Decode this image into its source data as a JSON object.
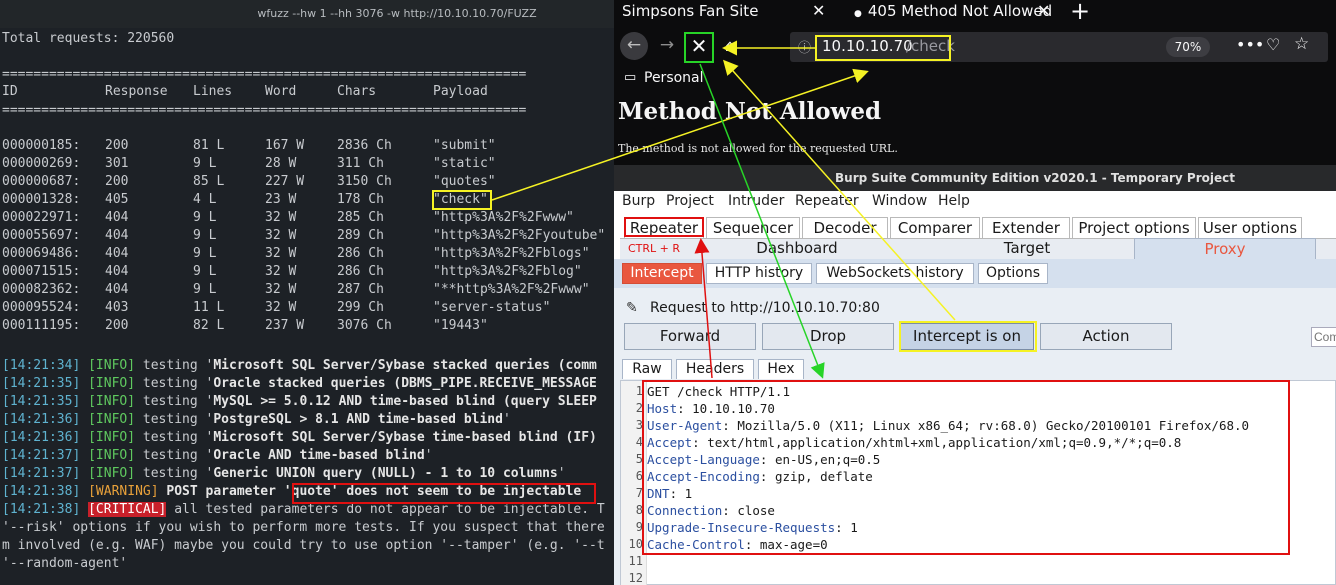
{
  "terminal": {
    "title": "wfuzz --hw 1 --hh 3076 -w http://10.10.10.70/FUZZ",
    "total_requests": "Total requests: 220560",
    "separator": "===================================================================",
    "headers": {
      "id": "ID",
      "response": "Response",
      "lines": "Lines",
      "word": "Word",
      "chars": "Chars",
      "payload": "Payload"
    },
    "rows": [
      {
        "id": "000000185:",
        "response": "200",
        "lines": "81 L",
        "word": "167 W",
        "chars": "2836 Ch",
        "payload": "\"submit\""
      },
      {
        "id": "000000269:",
        "response": "301",
        "lines": "9 L",
        "word": "28 W",
        "chars": "311 Ch",
        "payload": "\"static\""
      },
      {
        "id": "000000687:",
        "response": "200",
        "lines": "85 L",
        "word": "227 W",
        "chars": "3150 Ch",
        "payload": "\"quotes\""
      },
      {
        "id": "000001328:",
        "response": "405",
        "lines": "4 L",
        "word": "23 W",
        "chars": "178 Ch",
        "payload": "\"check\""
      },
      {
        "id": "000022971:",
        "response": "404",
        "lines": "9 L",
        "word": "32 W",
        "chars": "285 Ch",
        "payload": "\"http%3A%2F%2Fwww\""
      },
      {
        "id": "000055697:",
        "response": "404",
        "lines": "9 L",
        "word": "32 W",
        "chars": "289 Ch",
        "payload": "\"http%3A%2F%2Fyoutube\""
      },
      {
        "id": "000069486:",
        "response": "404",
        "lines": "9 L",
        "word": "32 W",
        "chars": "286 Ch",
        "payload": "\"http%3A%2F%2Fblogs\""
      },
      {
        "id": "000071515:",
        "response": "404",
        "lines": "9 L",
        "word": "32 W",
        "chars": "286 Ch",
        "payload": "\"http%3A%2F%2Fblog\""
      },
      {
        "id": "000082362:",
        "response": "404",
        "lines": "9 L",
        "word": "32 W",
        "chars": "287 Ch",
        "payload": "\"**http%3A%2F%2Fwww\""
      },
      {
        "id": "000095524:",
        "response": "403",
        "lines": "11 L",
        "word": "32 W",
        "chars": "299 Ch",
        "payload": "\"server-status\""
      },
      {
        "id": "000111195:",
        "response": "200",
        "lines": "82 L",
        "word": "237 W",
        "chars": "3076 Ch",
        "payload": "\"19443\""
      }
    ],
    "logs": [
      {
        "ts": "[14:21:34]",
        "level": "[INFO]",
        "pre": " testing '",
        "bold": "Microsoft SQL Server/Sybase stacked queries (comm",
        "post": ""
      },
      {
        "ts": "[14:21:35]",
        "level": "[INFO]",
        "pre": " testing '",
        "bold": "Oracle stacked queries (DBMS_PIPE.RECEIVE_MESSAGE",
        "post": ""
      },
      {
        "ts": "[14:21:35]",
        "level": "[INFO]",
        "pre": " testing '",
        "bold": "MySQL >= 5.0.12 AND time-based blind (query SLEEP",
        "post": ""
      },
      {
        "ts": "[14:21:36]",
        "level": "[INFO]",
        "pre": " testing '",
        "bold": "PostgreSQL > 8.1 AND time-based blind",
        "post": "'"
      },
      {
        "ts": "[14:21:36]",
        "level": "[INFO]",
        "pre": " testing '",
        "bold": "Microsoft SQL Server/Sybase time-based blind (IF)",
        "post": ""
      },
      {
        "ts": "[14:21:37]",
        "level": "[INFO]",
        "pre": " testing '",
        "bold": "Oracle AND time-based blind",
        "post": "'"
      },
      {
        "ts": "[14:21:37]",
        "level": "[INFO]",
        "pre": " testing '",
        "bold": "Generic UNION query (NULL) - 1 to 10 columns",
        "post": "'"
      }
    ],
    "warning": {
      "ts": "[14:21:38]",
      "level": "[WARNING]",
      "text1": " POST parameter '",
      "param": "quote",
      "text2": "' does not seem to be injectable"
    },
    "critical": {
      "ts": "[14:21:38]",
      "level": "[CRITICAL]",
      "text": " all tested parameters do not appear to be injectable. T"
    },
    "tail": [
      "'--risk' options if you wish to perform more tests. If you suspect that there",
      "m involved (e.g. WAF) maybe you could try to use option '--tamper' (e.g. '--t",
      "'--random-agent'"
    ]
  },
  "firefox": {
    "tabs": [
      {
        "label": "Simpsons Fan Site"
      },
      {
        "label": "405 Method Not Allowed"
      }
    ],
    "url_host": "10.10.10.70",
    "url_path": "/check",
    "zoom": "70%",
    "bookmark": "Personal",
    "page_heading": "Method Not Allowed",
    "page_message": "The method is not allowed for the requested URL."
  },
  "burp": {
    "title": "Burp Suite Community Edition v2020.1 - Temporary Project",
    "menu": [
      "Burp",
      "Project",
      "Intruder",
      "Repeater",
      "Window",
      "Help"
    ],
    "tabs_row1": [
      "Repeater",
      "Sequencer",
      "Decoder",
      "Comparer",
      "Extender",
      "Project options",
      "User options"
    ],
    "shortcut": "CTRL + R",
    "tabs_row2": [
      "Dashboard",
      "Target",
      "Proxy"
    ],
    "subtabs": [
      "Intercept",
      "HTTP history",
      "WebSockets history",
      "Options"
    ],
    "request_to": "Request to http://10.10.10.70:80",
    "buttons": {
      "forward": "Forward",
      "drop": "Drop",
      "intercept": "Intercept is on",
      "action": "Action"
    },
    "comment_placeholder": "Com",
    "editor_tabs": [
      "Raw",
      "Headers",
      "Hex"
    ],
    "request_lines": [
      {
        "n": "1",
        "k": "",
        "v": "GET /check HTTP/1.1"
      },
      {
        "n": "2",
        "k": "Host",
        "v": ": 10.10.10.70"
      },
      {
        "n": "3",
        "k": "User-Agent",
        "v": ": Mozilla/5.0 (X11; Linux x86_64; rv:68.0) Gecko/20100101 Firefox/68.0"
      },
      {
        "n": "4",
        "k": "Accept",
        "v": ": text/html,application/xhtml+xml,application/xml;q=0.9,*/*;q=0.8"
      },
      {
        "n": "5",
        "k": "Accept-Language",
        "v": ": en-US,en;q=0.5"
      },
      {
        "n": "6",
        "k": "Accept-Encoding",
        "v": ": gzip, deflate"
      },
      {
        "n": "7",
        "k": "DNT",
        "v": ": 1"
      },
      {
        "n": "8",
        "k": "Connection",
        "v": ": close"
      },
      {
        "n": "9",
        "k": "Upgrade-Insecure-Requests",
        "v": ": 1"
      },
      {
        "n": "10",
        "k": "Cache-Control",
        "v": ": max-age=0"
      },
      {
        "n": "11",
        "k": "",
        "v": ""
      },
      {
        "n": "12",
        "k": "",
        "v": ""
      }
    ]
  }
}
